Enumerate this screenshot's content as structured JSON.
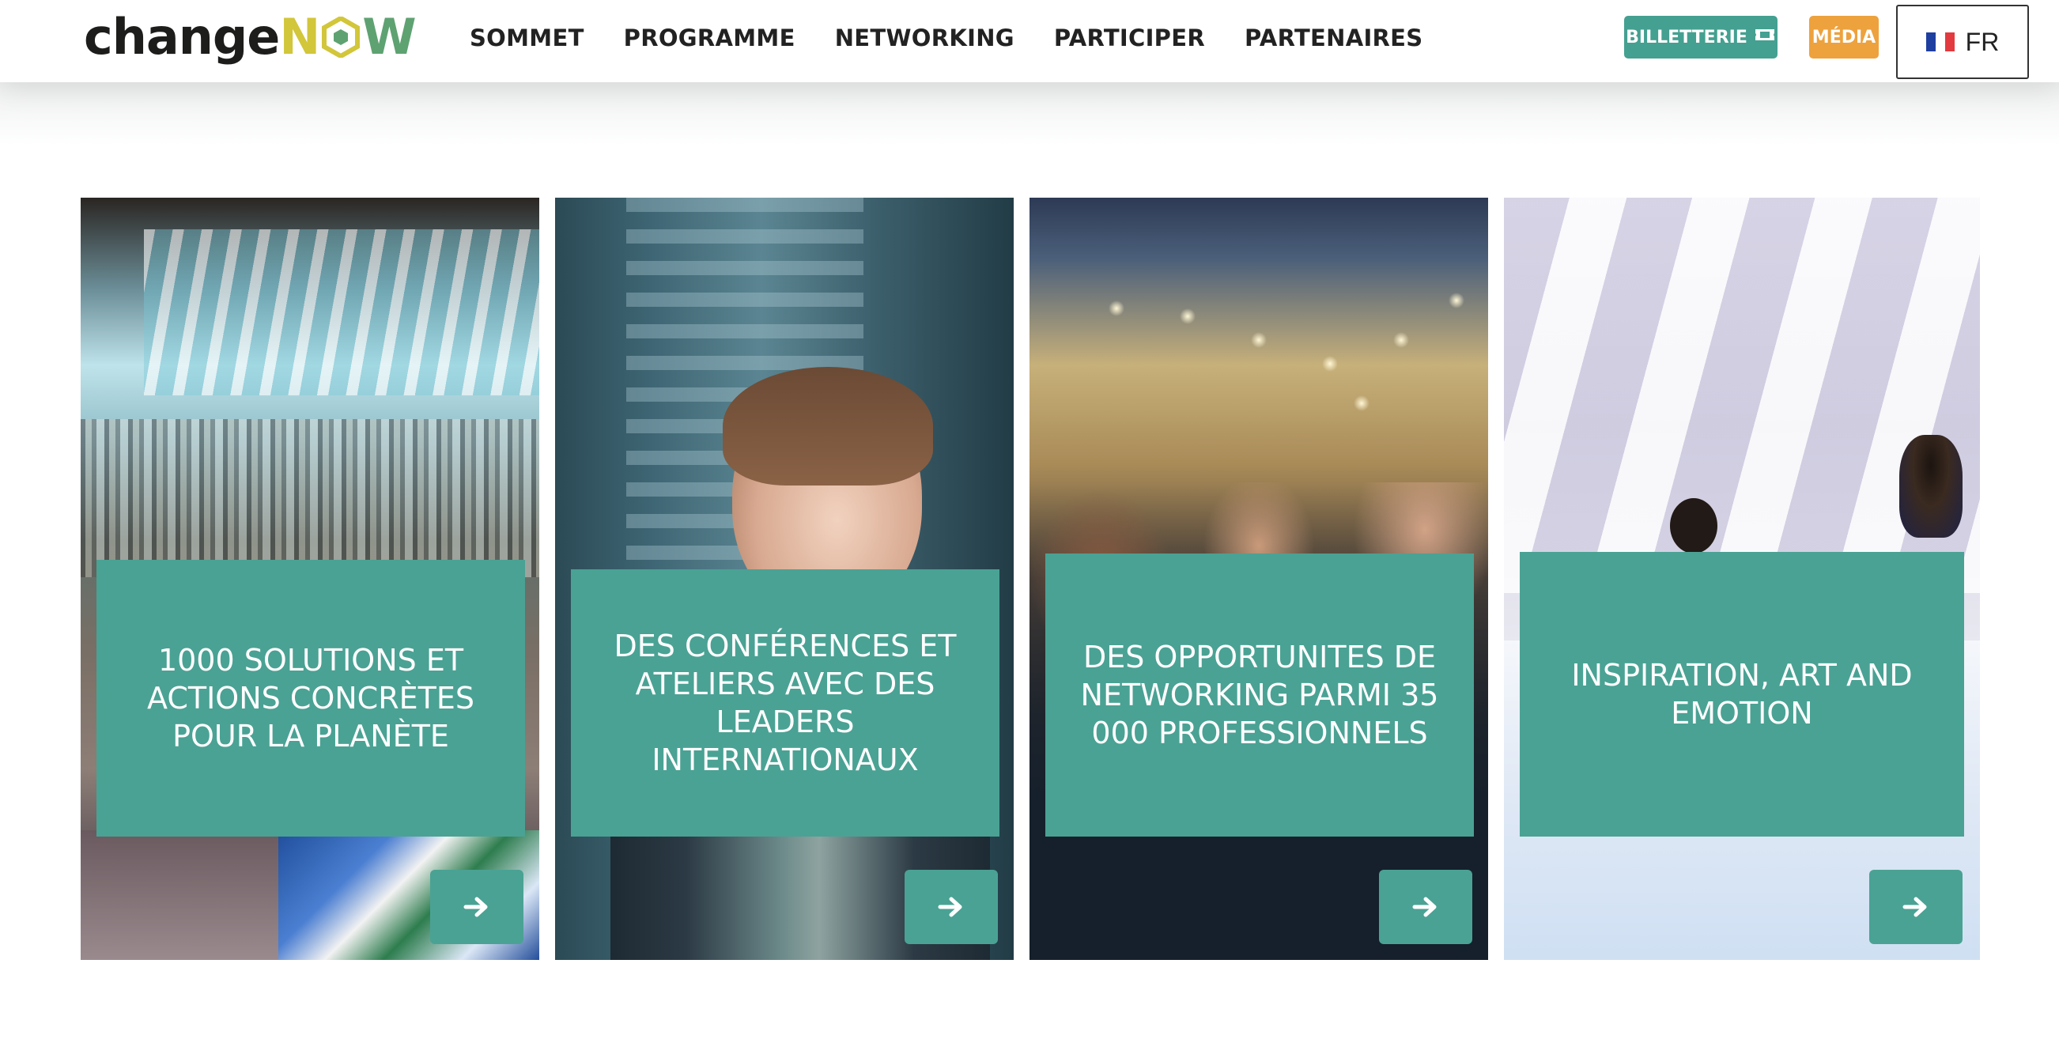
{
  "header": {
    "logo": {
      "part1": "change",
      "part2": "N",
      "part3": "W"
    },
    "nav": [
      "SOMMET",
      "PROGRAMME",
      "NETWORKING",
      "PARTICIPER",
      "PARTENAIRES"
    ],
    "billetterie_label": "BILLETTERIE",
    "media_label": "MÉDIA",
    "language": "FR"
  },
  "cards": [
    {
      "title": "1000 SOLUTIONS ET ACTIONS CONCRÈTES POUR LA PLANÈTE"
    },
    {
      "title": "DES CONFÉRENCES ET ATELIERS AVEC DES LEADERS INTERNATIONAUX"
    },
    {
      "title": "DES OPPORTUNITES DE NETWORKING PARMI 35 000 PROFESSIONNELS"
    },
    {
      "title": "INSPIRATION, ART AND EMOTION"
    }
  ],
  "colors": {
    "teal": "#4aa294",
    "billetterie": "#44a091",
    "media": "#eda23d",
    "logo_yellow": "#d2c63a",
    "logo_green": "#5ea272"
  },
  "icons": {
    "ticket": "ticket-icon",
    "arrow": "arrow-right-icon",
    "flag": "france-flag-icon"
  }
}
